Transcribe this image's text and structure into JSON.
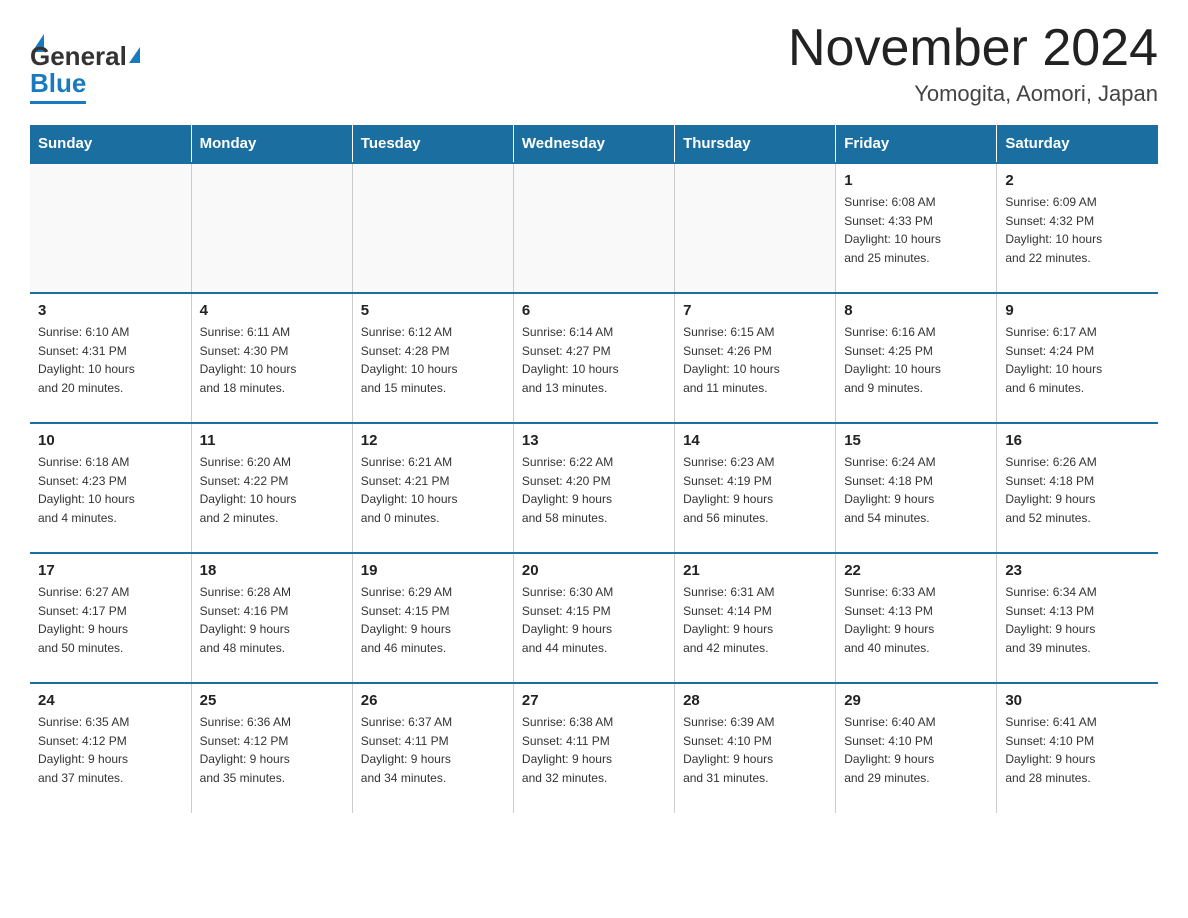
{
  "header": {
    "title": "November 2024",
    "subtitle": "Yomogita, Aomori, Japan",
    "logo_general": "General",
    "logo_blue": "Blue"
  },
  "weekdays": [
    "Sunday",
    "Monday",
    "Tuesday",
    "Wednesday",
    "Thursday",
    "Friday",
    "Saturday"
  ],
  "weeks": [
    [
      {
        "day": "",
        "info": ""
      },
      {
        "day": "",
        "info": ""
      },
      {
        "day": "",
        "info": ""
      },
      {
        "day": "",
        "info": ""
      },
      {
        "day": "",
        "info": ""
      },
      {
        "day": "1",
        "info": "Sunrise: 6:08 AM\nSunset: 4:33 PM\nDaylight: 10 hours\nand 25 minutes."
      },
      {
        "day": "2",
        "info": "Sunrise: 6:09 AM\nSunset: 4:32 PM\nDaylight: 10 hours\nand 22 minutes."
      }
    ],
    [
      {
        "day": "3",
        "info": "Sunrise: 6:10 AM\nSunset: 4:31 PM\nDaylight: 10 hours\nand 20 minutes."
      },
      {
        "day": "4",
        "info": "Sunrise: 6:11 AM\nSunset: 4:30 PM\nDaylight: 10 hours\nand 18 minutes."
      },
      {
        "day": "5",
        "info": "Sunrise: 6:12 AM\nSunset: 4:28 PM\nDaylight: 10 hours\nand 15 minutes."
      },
      {
        "day": "6",
        "info": "Sunrise: 6:14 AM\nSunset: 4:27 PM\nDaylight: 10 hours\nand 13 minutes."
      },
      {
        "day": "7",
        "info": "Sunrise: 6:15 AM\nSunset: 4:26 PM\nDaylight: 10 hours\nand 11 minutes."
      },
      {
        "day": "8",
        "info": "Sunrise: 6:16 AM\nSunset: 4:25 PM\nDaylight: 10 hours\nand 9 minutes."
      },
      {
        "day": "9",
        "info": "Sunrise: 6:17 AM\nSunset: 4:24 PM\nDaylight: 10 hours\nand 6 minutes."
      }
    ],
    [
      {
        "day": "10",
        "info": "Sunrise: 6:18 AM\nSunset: 4:23 PM\nDaylight: 10 hours\nand 4 minutes."
      },
      {
        "day": "11",
        "info": "Sunrise: 6:20 AM\nSunset: 4:22 PM\nDaylight: 10 hours\nand 2 minutes."
      },
      {
        "day": "12",
        "info": "Sunrise: 6:21 AM\nSunset: 4:21 PM\nDaylight: 10 hours\nand 0 minutes."
      },
      {
        "day": "13",
        "info": "Sunrise: 6:22 AM\nSunset: 4:20 PM\nDaylight: 9 hours\nand 58 minutes."
      },
      {
        "day": "14",
        "info": "Sunrise: 6:23 AM\nSunset: 4:19 PM\nDaylight: 9 hours\nand 56 minutes."
      },
      {
        "day": "15",
        "info": "Sunrise: 6:24 AM\nSunset: 4:18 PM\nDaylight: 9 hours\nand 54 minutes."
      },
      {
        "day": "16",
        "info": "Sunrise: 6:26 AM\nSunset: 4:18 PM\nDaylight: 9 hours\nand 52 minutes."
      }
    ],
    [
      {
        "day": "17",
        "info": "Sunrise: 6:27 AM\nSunset: 4:17 PM\nDaylight: 9 hours\nand 50 minutes."
      },
      {
        "day": "18",
        "info": "Sunrise: 6:28 AM\nSunset: 4:16 PM\nDaylight: 9 hours\nand 48 minutes."
      },
      {
        "day": "19",
        "info": "Sunrise: 6:29 AM\nSunset: 4:15 PM\nDaylight: 9 hours\nand 46 minutes."
      },
      {
        "day": "20",
        "info": "Sunrise: 6:30 AM\nSunset: 4:15 PM\nDaylight: 9 hours\nand 44 minutes."
      },
      {
        "day": "21",
        "info": "Sunrise: 6:31 AM\nSunset: 4:14 PM\nDaylight: 9 hours\nand 42 minutes."
      },
      {
        "day": "22",
        "info": "Sunrise: 6:33 AM\nSunset: 4:13 PM\nDaylight: 9 hours\nand 40 minutes."
      },
      {
        "day": "23",
        "info": "Sunrise: 6:34 AM\nSunset: 4:13 PM\nDaylight: 9 hours\nand 39 minutes."
      }
    ],
    [
      {
        "day": "24",
        "info": "Sunrise: 6:35 AM\nSunset: 4:12 PM\nDaylight: 9 hours\nand 37 minutes."
      },
      {
        "day": "25",
        "info": "Sunrise: 6:36 AM\nSunset: 4:12 PM\nDaylight: 9 hours\nand 35 minutes."
      },
      {
        "day": "26",
        "info": "Sunrise: 6:37 AM\nSunset: 4:11 PM\nDaylight: 9 hours\nand 34 minutes."
      },
      {
        "day": "27",
        "info": "Sunrise: 6:38 AM\nSunset: 4:11 PM\nDaylight: 9 hours\nand 32 minutes."
      },
      {
        "day": "28",
        "info": "Sunrise: 6:39 AM\nSunset: 4:10 PM\nDaylight: 9 hours\nand 31 minutes."
      },
      {
        "day": "29",
        "info": "Sunrise: 6:40 AM\nSunset: 4:10 PM\nDaylight: 9 hours\nand 29 minutes."
      },
      {
        "day": "30",
        "info": "Sunrise: 6:41 AM\nSunset: 4:10 PM\nDaylight: 9 hours\nand 28 minutes."
      }
    ]
  ]
}
